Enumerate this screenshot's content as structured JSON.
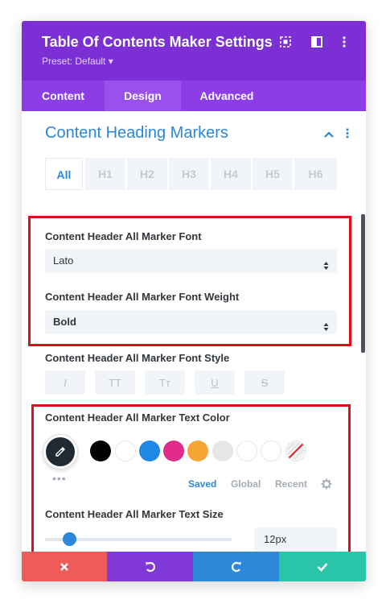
{
  "header": {
    "title": "Table Of Contents Maker Settings",
    "preset": "Preset: Default ▾"
  },
  "tabs": [
    {
      "label": "Content",
      "active": false
    },
    {
      "label": "Design",
      "active": true
    },
    {
      "label": "Advanced",
      "active": false
    }
  ],
  "section": {
    "title": "Content Heading Markers"
  },
  "heading_tabs": [
    "All",
    "H1",
    "H2",
    "H3",
    "H4",
    "H5",
    "H6"
  ],
  "font": {
    "label": "Content Header All Marker Font",
    "value": "Lato"
  },
  "font_weight": {
    "label": "Content Header All Marker Font Weight",
    "value": "Bold"
  },
  "font_style": {
    "label": "Content Header All Marker Font Style",
    "buttons": [
      "I",
      "TT",
      "Tт",
      "U",
      "S"
    ]
  },
  "text_color": {
    "label": "Content Header All Marker Text Color",
    "more": "•••",
    "swatches": [
      "#000000",
      "#ffffff",
      "#1e88e5",
      "#e02b8a",
      "#f4a533",
      "#e6e6e6",
      "#ffffff",
      "#ffffff",
      "none"
    ],
    "tabs": [
      "Saved",
      "Global",
      "Recent"
    ]
  },
  "text_size": {
    "label": "Content Header All Marker Text Size",
    "value": "12px",
    "slider_fraction": 0.1
  },
  "colors": {
    "header_bg": "#7b2fd4",
    "tabs_bg": "#8c3de5",
    "accent": "#2b87da",
    "highlight": "#e0101a",
    "cancel": "#ef5a5a",
    "undo": "#8039d6",
    "redo": "#2e88d9",
    "save": "#29c4a9"
  }
}
